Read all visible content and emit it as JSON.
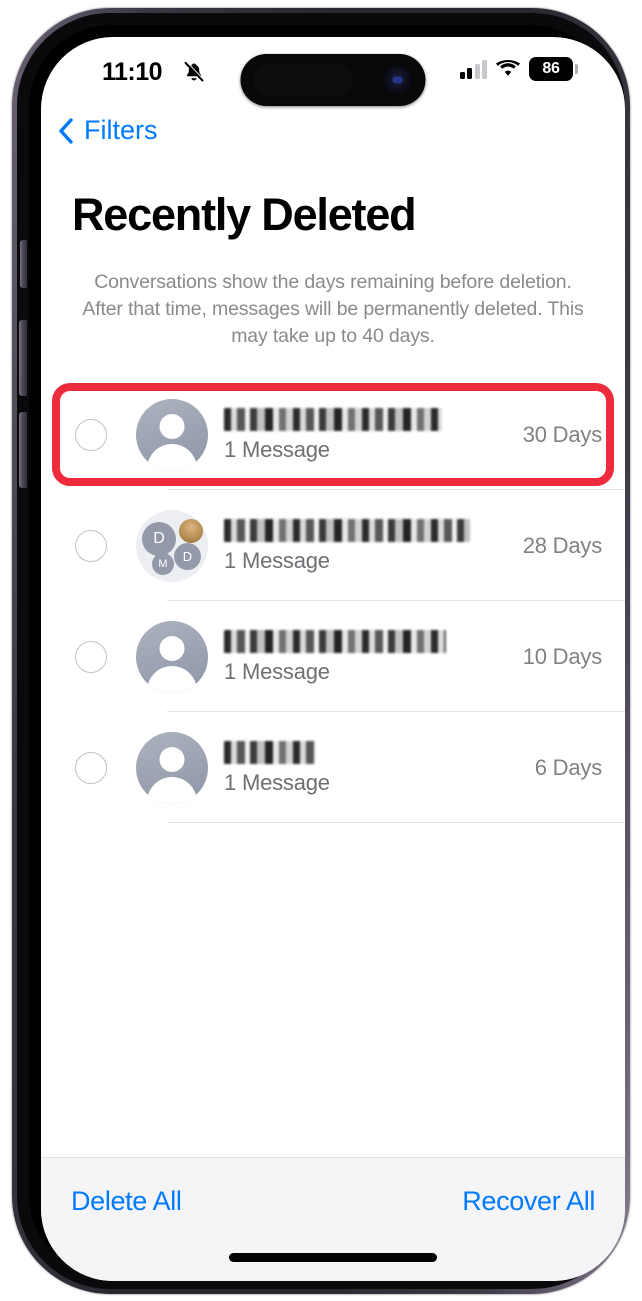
{
  "status_bar": {
    "time": "11:10",
    "silent_icon": "bell-slash-icon",
    "signal_icon": "cellular-signal-icon",
    "signal_bars_filled": 2,
    "signal_bars_total": 4,
    "wifi_icon": "wifi-icon",
    "battery_level": "86",
    "battery_icon": "battery-icon"
  },
  "nav": {
    "back_icon": "chevron-left-icon",
    "back_label": "Filters"
  },
  "page": {
    "title": "Recently Deleted",
    "description": "Conversations show the days remaining before deletion. After that time, messages will be permanently deleted. This may take up to 40 days."
  },
  "conversations": [
    {
      "name_redacted": true,
      "name_width": 218,
      "message_count": "1 Message",
      "days_remaining": "30 Days",
      "avatar_type": "person",
      "selected": false,
      "highlighted": true
    },
    {
      "name_redacted": true,
      "name_width": 246,
      "message_count": "1 Message",
      "days_remaining": "28 Days",
      "avatar_type": "group",
      "group_initials": [
        "D",
        "",
        "D",
        "M"
      ],
      "selected": false,
      "highlighted": false
    },
    {
      "name_redacted": true,
      "name_width": 222,
      "message_count": "1 Message",
      "days_remaining": "10 Days",
      "avatar_type": "person",
      "selected": false,
      "highlighted": false
    },
    {
      "name_redacted": true,
      "name_width": 92,
      "message_count": "1 Message",
      "days_remaining": "6 Days",
      "avatar_type": "person",
      "selected": false,
      "highlighted": false
    }
  ],
  "toolbar": {
    "delete_all_label": "Delete All",
    "recover_all_label": "Recover All"
  },
  "colors": {
    "accent_blue": "#007aff",
    "annotation_red": "#ee2b3c",
    "secondary_text": "#8a8a8e",
    "toolbar_background": "#f5f5f7"
  }
}
